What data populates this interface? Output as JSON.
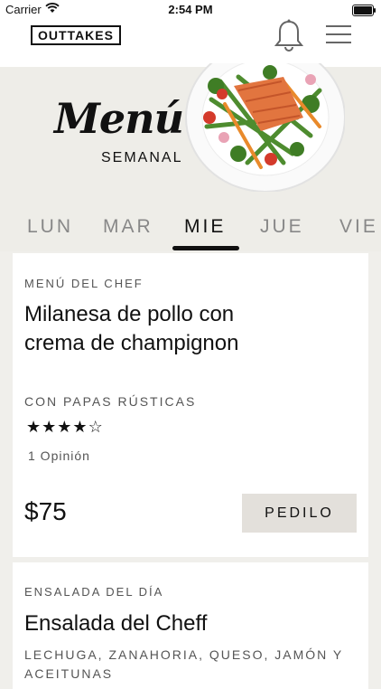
{
  "status_bar": {
    "carrier": "Carrier",
    "time": "2:54 PM"
  },
  "header": {
    "logo": "OUTTAKES",
    "bell_icon": "bell-icon",
    "menu_icon": "hamburger-menu-icon"
  },
  "hero": {
    "title": "Menú",
    "subtitle": "SEMANAL",
    "image": "salmon-vegetables-plate"
  },
  "days": [
    {
      "label": "LUN",
      "active": false
    },
    {
      "label": "MAR",
      "active": false
    },
    {
      "label": "MIE",
      "active": true
    },
    {
      "label": "JUE",
      "active": false
    },
    {
      "label": "VIE",
      "active": false
    }
  ],
  "dishes": [
    {
      "category": "MENÚ DEL CHEF",
      "name": "Milanesa de pollo con crema de champignon",
      "side": "CON PAPAS RÚSTICAS",
      "rating": 4,
      "rating_max": 5,
      "reviews": "1 Opinión",
      "price": "$75",
      "order_label": "PEDILO"
    },
    {
      "category": "ENSALADA DEL DÍA",
      "name": "Ensalada del Cheff",
      "side": "LECHUGA, ZANAHORIA, QUESO, JAMÓN Y ACEITUNAS"
    }
  ],
  "colors": {
    "background": "#eeede8",
    "card": "#ffffff",
    "button": "#e3e0db",
    "text": "#111111",
    "muted": "#555555"
  }
}
